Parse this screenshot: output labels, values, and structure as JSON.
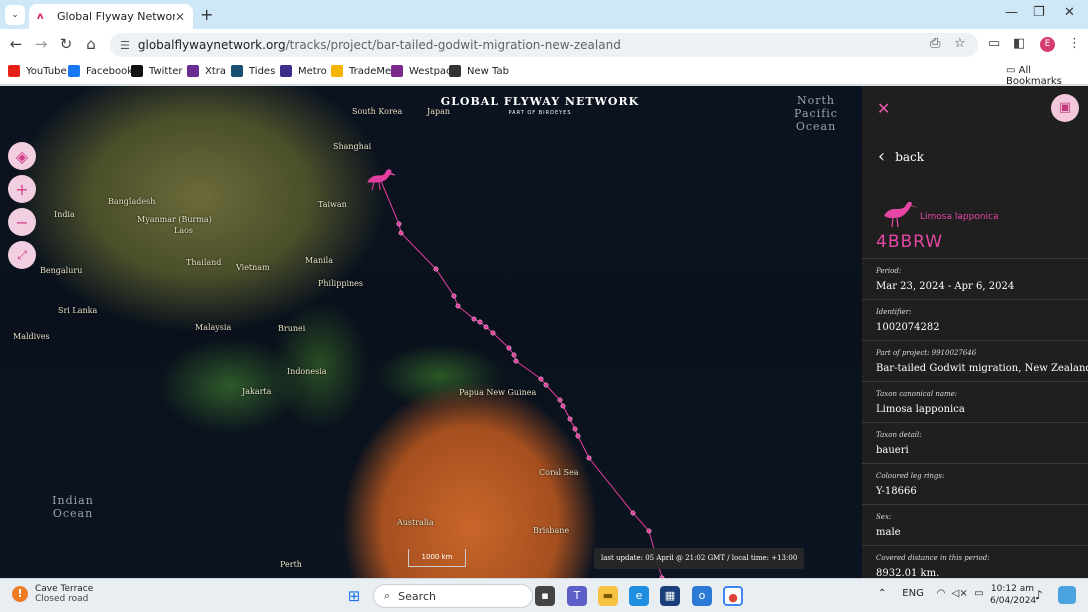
{
  "browser": {
    "tab": {
      "title": "Global Flyway Network",
      "close": "✕"
    },
    "new_tab": "+",
    "window": {
      "minimize": "—",
      "maximize": "❐",
      "close": "✕"
    },
    "nav": {
      "back": "←",
      "forward": "→",
      "reload": "↻",
      "home": "⌂"
    },
    "url_host": "globalflywaynetwork.org",
    "url_path": "/tracks/project/bar-tailed-godwit-migration-new-zealand",
    "profile_initial": "E"
  },
  "bookmarks": [
    {
      "label": "YouTube",
      "color": "#e62117",
      "icon": "youtube-icon"
    },
    {
      "label": "Facebook",
      "color": "#1877f2",
      "icon": "facebook-icon"
    },
    {
      "label": "Twitter",
      "color": "#111111",
      "icon": "x-icon"
    },
    {
      "label": "Xtra",
      "color": "#6a2c91",
      "icon": "xtra-icon"
    },
    {
      "label": "Tides",
      "color": "#1b4f72",
      "icon": "tides-icon"
    },
    {
      "label": "Metro",
      "color": "#3b2e8a",
      "icon": "metro-icon"
    },
    {
      "label": "TradeMe",
      "color": "#f4b400",
      "icon": "trademe-icon"
    },
    {
      "label": "Westpac",
      "color": "#7b2a8c",
      "icon": "westpac-icon"
    },
    {
      "label": "New Tab",
      "color": "#333333",
      "icon": "globe-icon"
    }
  ],
  "all_bookmarks": "All Bookmarks",
  "map": {
    "brand_title": "GLOBAL FLYWAY NETWORK",
    "brand_subtitle": "PART OF BIRDEYES",
    "labels": [
      {
        "text": "South Korea"
      },
      {
        "text": "Japan"
      },
      {
        "text": "Shanghai"
      },
      {
        "text": "Taiwan"
      },
      {
        "text": "India"
      },
      {
        "text": "Bangladesh"
      },
      {
        "text": "Myanmar (Burma)"
      },
      {
        "text": "Laos"
      },
      {
        "text": "Thailand"
      },
      {
        "text": "Vietnam"
      },
      {
        "text": "Manila"
      },
      {
        "text": "Philippines"
      },
      {
        "text": "Bengaluru"
      },
      {
        "text": "Sri Lanka"
      },
      {
        "text": "Maldives"
      },
      {
        "text": "Malaysia"
      },
      {
        "text": "Brunei"
      },
      {
        "text": "Indonesia"
      },
      {
        "text": "Jakarta"
      },
      {
        "text": "Papua New Guinea"
      },
      {
        "text": "Coral Sea"
      },
      {
        "text": "Australia"
      },
      {
        "text": "Brisbane"
      },
      {
        "text": "Perth"
      }
    ],
    "oceans": [
      {
        "text": "North Pacific Ocean"
      },
      {
        "text": "Indian Ocean"
      }
    ],
    "scale_label": "1000 km",
    "last_update": "last update: 05 April @ 21:02 GMT / local time: +13:00",
    "track_color": "#e33fa0"
  },
  "panel": {
    "back_label": "back",
    "species": "Limosa lapponica",
    "code": "4BBRW",
    "fields": [
      {
        "key": "Period:",
        "value": "Mar 23, 2024 - Apr 6, 2024"
      },
      {
        "key": "Identifier:",
        "value": "1002074282"
      },
      {
        "key": "Part of project: 9910027646",
        "value": "Bar-tailed Godwit migration, New Zealand"
      },
      {
        "key": "Taxon canonical name:",
        "value": "Limosa lapponica"
      },
      {
        "key": "Taxon detail:",
        "value": "baueri"
      },
      {
        "key": "Coloured leg rings:",
        "value": "Y-18666"
      },
      {
        "key": "Sex:",
        "value": "male"
      },
      {
        "key": "Covered distance in this period:",
        "value": "8932.01 km."
      }
    ]
  },
  "taskbar": {
    "weather_title": "Cave Terrace",
    "weather_sub": "Closed road",
    "search_label": "Search",
    "lang": "ENG",
    "time": "10:12 am",
    "date": "6/04/2024"
  }
}
